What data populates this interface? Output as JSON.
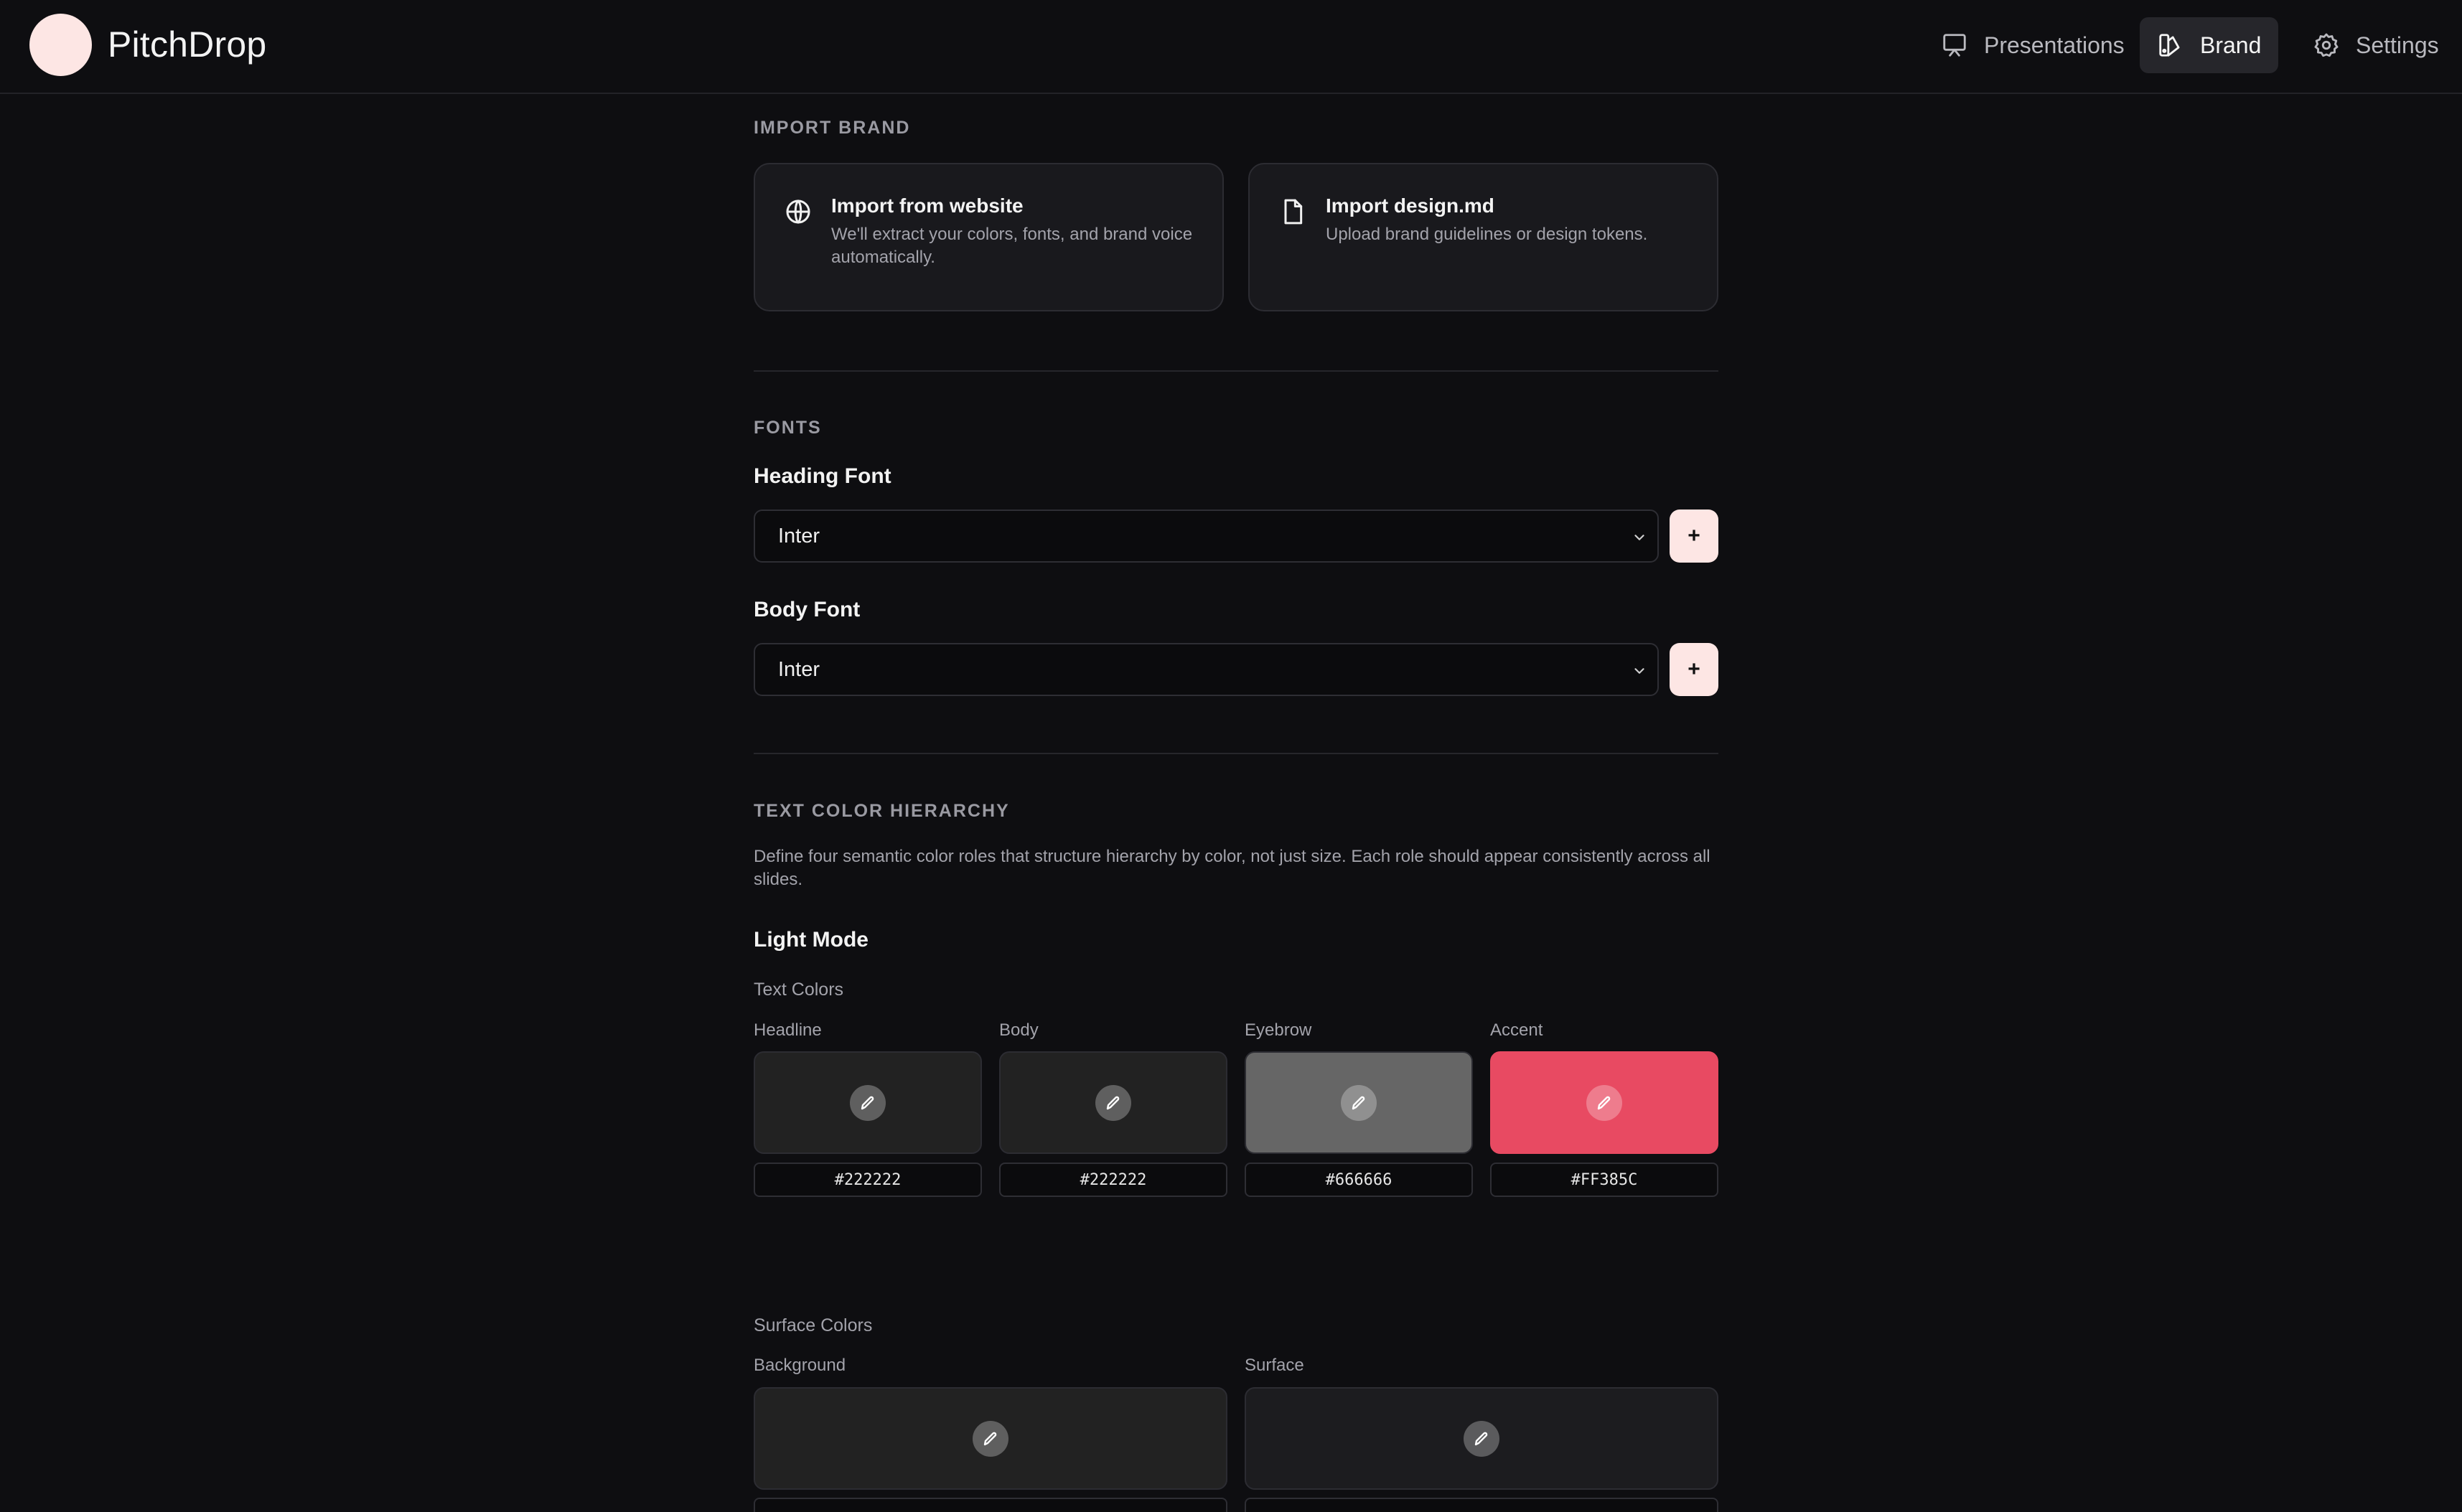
{
  "app": {
    "name": "PitchDrop",
    "nav": [
      {
        "label": "Presentations",
        "icon": "presentation-icon",
        "active": false
      },
      {
        "label": "Brand",
        "icon": "brand-icon",
        "active": true
      },
      {
        "label": "Settings",
        "icon": "gear-icon",
        "active": false
      }
    ]
  },
  "import_brand": {
    "section_label": "IMPORT BRAND",
    "cards": [
      {
        "title": "Import from website",
        "description": "We'll extract your colors, fonts, and brand voice automatically.",
        "icon": "globe-icon"
      },
      {
        "title": "Import design.md",
        "description": "Upload brand guidelines or design tokens.",
        "icon": "file-icon"
      }
    ]
  },
  "fonts": {
    "section_label": "FONTS",
    "heading": {
      "label": "Heading Font",
      "value": "Inter",
      "add_label": "+"
    },
    "body": {
      "label": "Body Font",
      "value": "Inter",
      "add_label": "+"
    }
  },
  "text_color": {
    "section_label": "TEXT COLOR HIERARCHY",
    "description": "Define four semantic color roles that structure hierarchy by color, not just size. Each role should appear consistently across all slides.",
    "mode_title": "Light Mode",
    "text_colors_label": "Text Colors",
    "text_colors": [
      {
        "label": "Headline",
        "hex": "#222222",
        "color": "#222222"
      },
      {
        "label": "Body",
        "hex": "#222222",
        "color": "#222222"
      },
      {
        "label": "Eyebrow",
        "hex": "#666666",
        "color": "#666666"
      },
      {
        "label": "Accent",
        "hex": "#FF385C",
        "color": "#e84a62"
      }
    ],
    "surface_colors_label": "Surface Colors",
    "surface_colors": [
      {
        "label": "Background",
        "color": "#222222"
      },
      {
        "label": "Surface",
        "color": "#1c1c1f"
      }
    ]
  }
}
